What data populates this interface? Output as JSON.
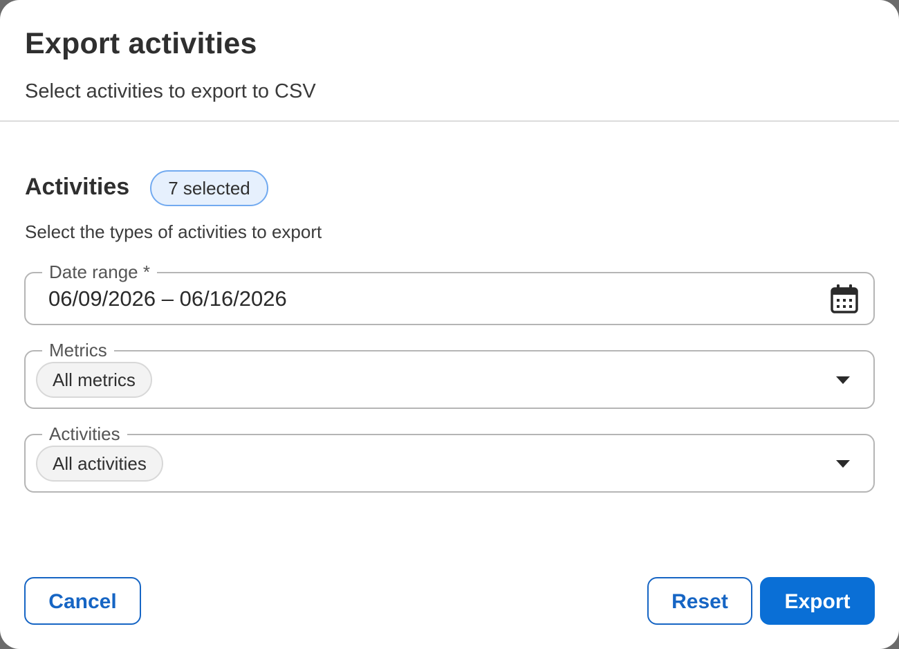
{
  "dialog": {
    "title": "Export activities",
    "subtitle": "Select activities to export to CSV"
  },
  "section": {
    "title": "Activities",
    "badge": "7 selected",
    "description": "Select the types of activities to export"
  },
  "fields": {
    "date_range": {
      "label": "Date range *",
      "value": "06/09/2026 – 06/16/2026",
      "icon": "calendar-icon"
    },
    "metrics": {
      "label": "Metrics",
      "chip": "All metrics",
      "icon": "chevron-down-icon"
    },
    "activities": {
      "label": "Activities",
      "chip": "All activities",
      "icon": "chevron-down-icon"
    }
  },
  "buttons": {
    "cancel": "Cancel",
    "reset": "Reset",
    "export": "Export"
  },
  "colors": {
    "accent": "#0a6fd6",
    "badge_border": "#72aaf0",
    "badge_bg": "#e6f0fd"
  }
}
